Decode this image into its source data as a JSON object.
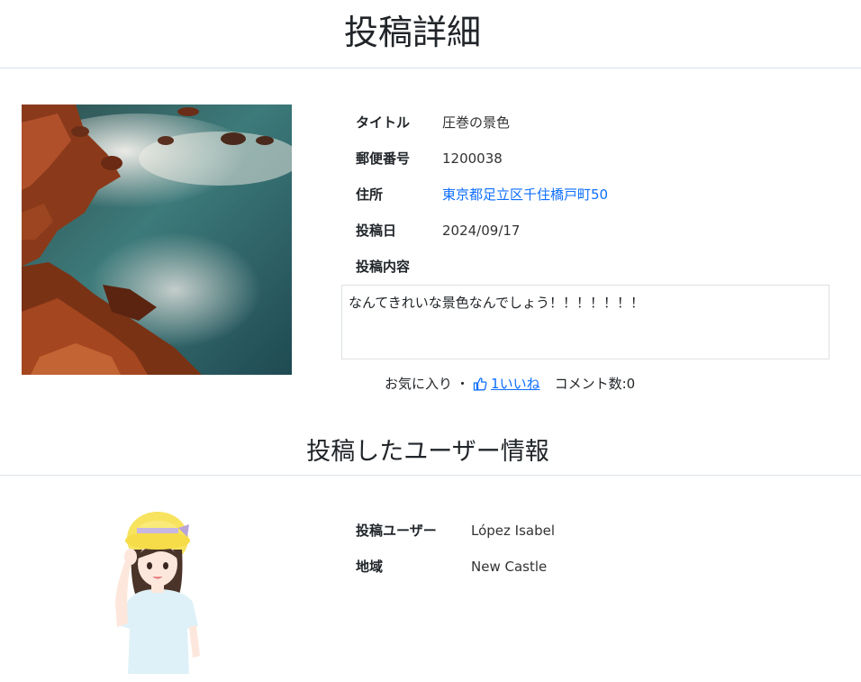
{
  "page": {
    "title": "投稿詳細"
  },
  "post": {
    "labels": {
      "title": "タイトル",
      "postal_code": "郵便番号",
      "address": "住所",
      "date": "投稿日",
      "content": "投稿内容"
    },
    "title": "圧巻の景色",
    "postal_code": "1200038",
    "address": "東京都足立区千住橋戸町50",
    "date": "2024/09/17",
    "content": "なんてきれいな景色なんでしょう！！！！！！！",
    "favorite_label": "お気に入り",
    "separator": "・",
    "like_label": "1いいね",
    "comment_label": "コメント数:0"
  },
  "user_section": {
    "title": "投稿したユーザー情報",
    "labels": {
      "user": "投稿ユーザー",
      "region": "地域"
    },
    "user": "López Isabel",
    "region": "New Castle"
  },
  "colors": {
    "link": "#0d6efd",
    "border": "#dee2e6",
    "text": "#212529"
  },
  "icons": {
    "like": "thumbs-up-icon"
  }
}
